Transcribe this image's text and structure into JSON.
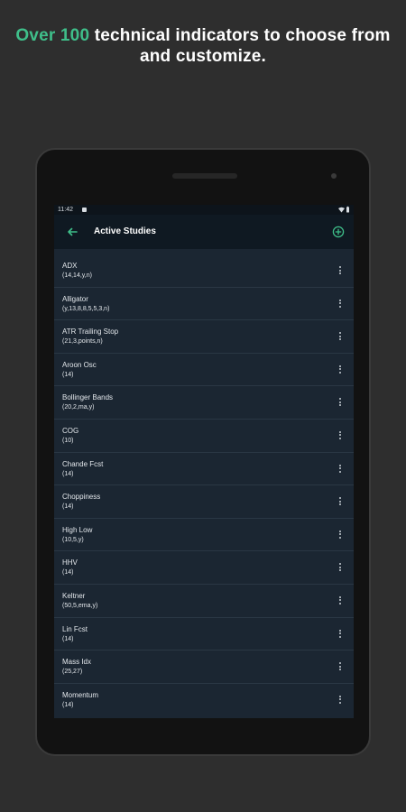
{
  "headline": {
    "accent": "Over 100",
    "text": " technical indicators to choose from and customize."
  },
  "status_bar": {
    "time": "11:42",
    "icons": [
      "wifi-icon",
      "battery-icon"
    ]
  },
  "app_bar": {
    "title": "Active Studies",
    "back_icon": "arrow-left-icon",
    "action_icon": "add-circle-icon"
  },
  "studies": [
    {
      "name": "ADX",
      "params": "(14,14,y,n)"
    },
    {
      "name": "Alligator",
      "params": "(y,13,8,8,5,5,3,n)"
    },
    {
      "name": "ATR Trailing Stop",
      "params": "(21,3,points,n)"
    },
    {
      "name": "Aroon Osc",
      "params": "(14)"
    },
    {
      "name": "Bollinger Bands",
      "params": "(20,2,ma,y)"
    },
    {
      "name": "COG",
      "params": "(10)"
    },
    {
      "name": "Chande Fcst",
      "params": "(14)"
    },
    {
      "name": "Choppiness",
      "params": "(14)"
    },
    {
      "name": "High Low",
      "params": "(10,5,y)"
    },
    {
      "name": "HHV",
      "params": "(14)"
    },
    {
      "name": "Keltner",
      "params": "(50,5,ema,y)"
    },
    {
      "name": "Lin Fcst",
      "params": "(14)"
    },
    {
      "name": "Mass Idx",
      "params": "(25,27)"
    },
    {
      "name": "Momentum",
      "params": "(14)"
    }
  ],
  "colors": {
    "accent": "#3fbf8a",
    "background": "#2e2e2e",
    "screen": "#1b2632",
    "app_bar": "#0f1922"
  }
}
